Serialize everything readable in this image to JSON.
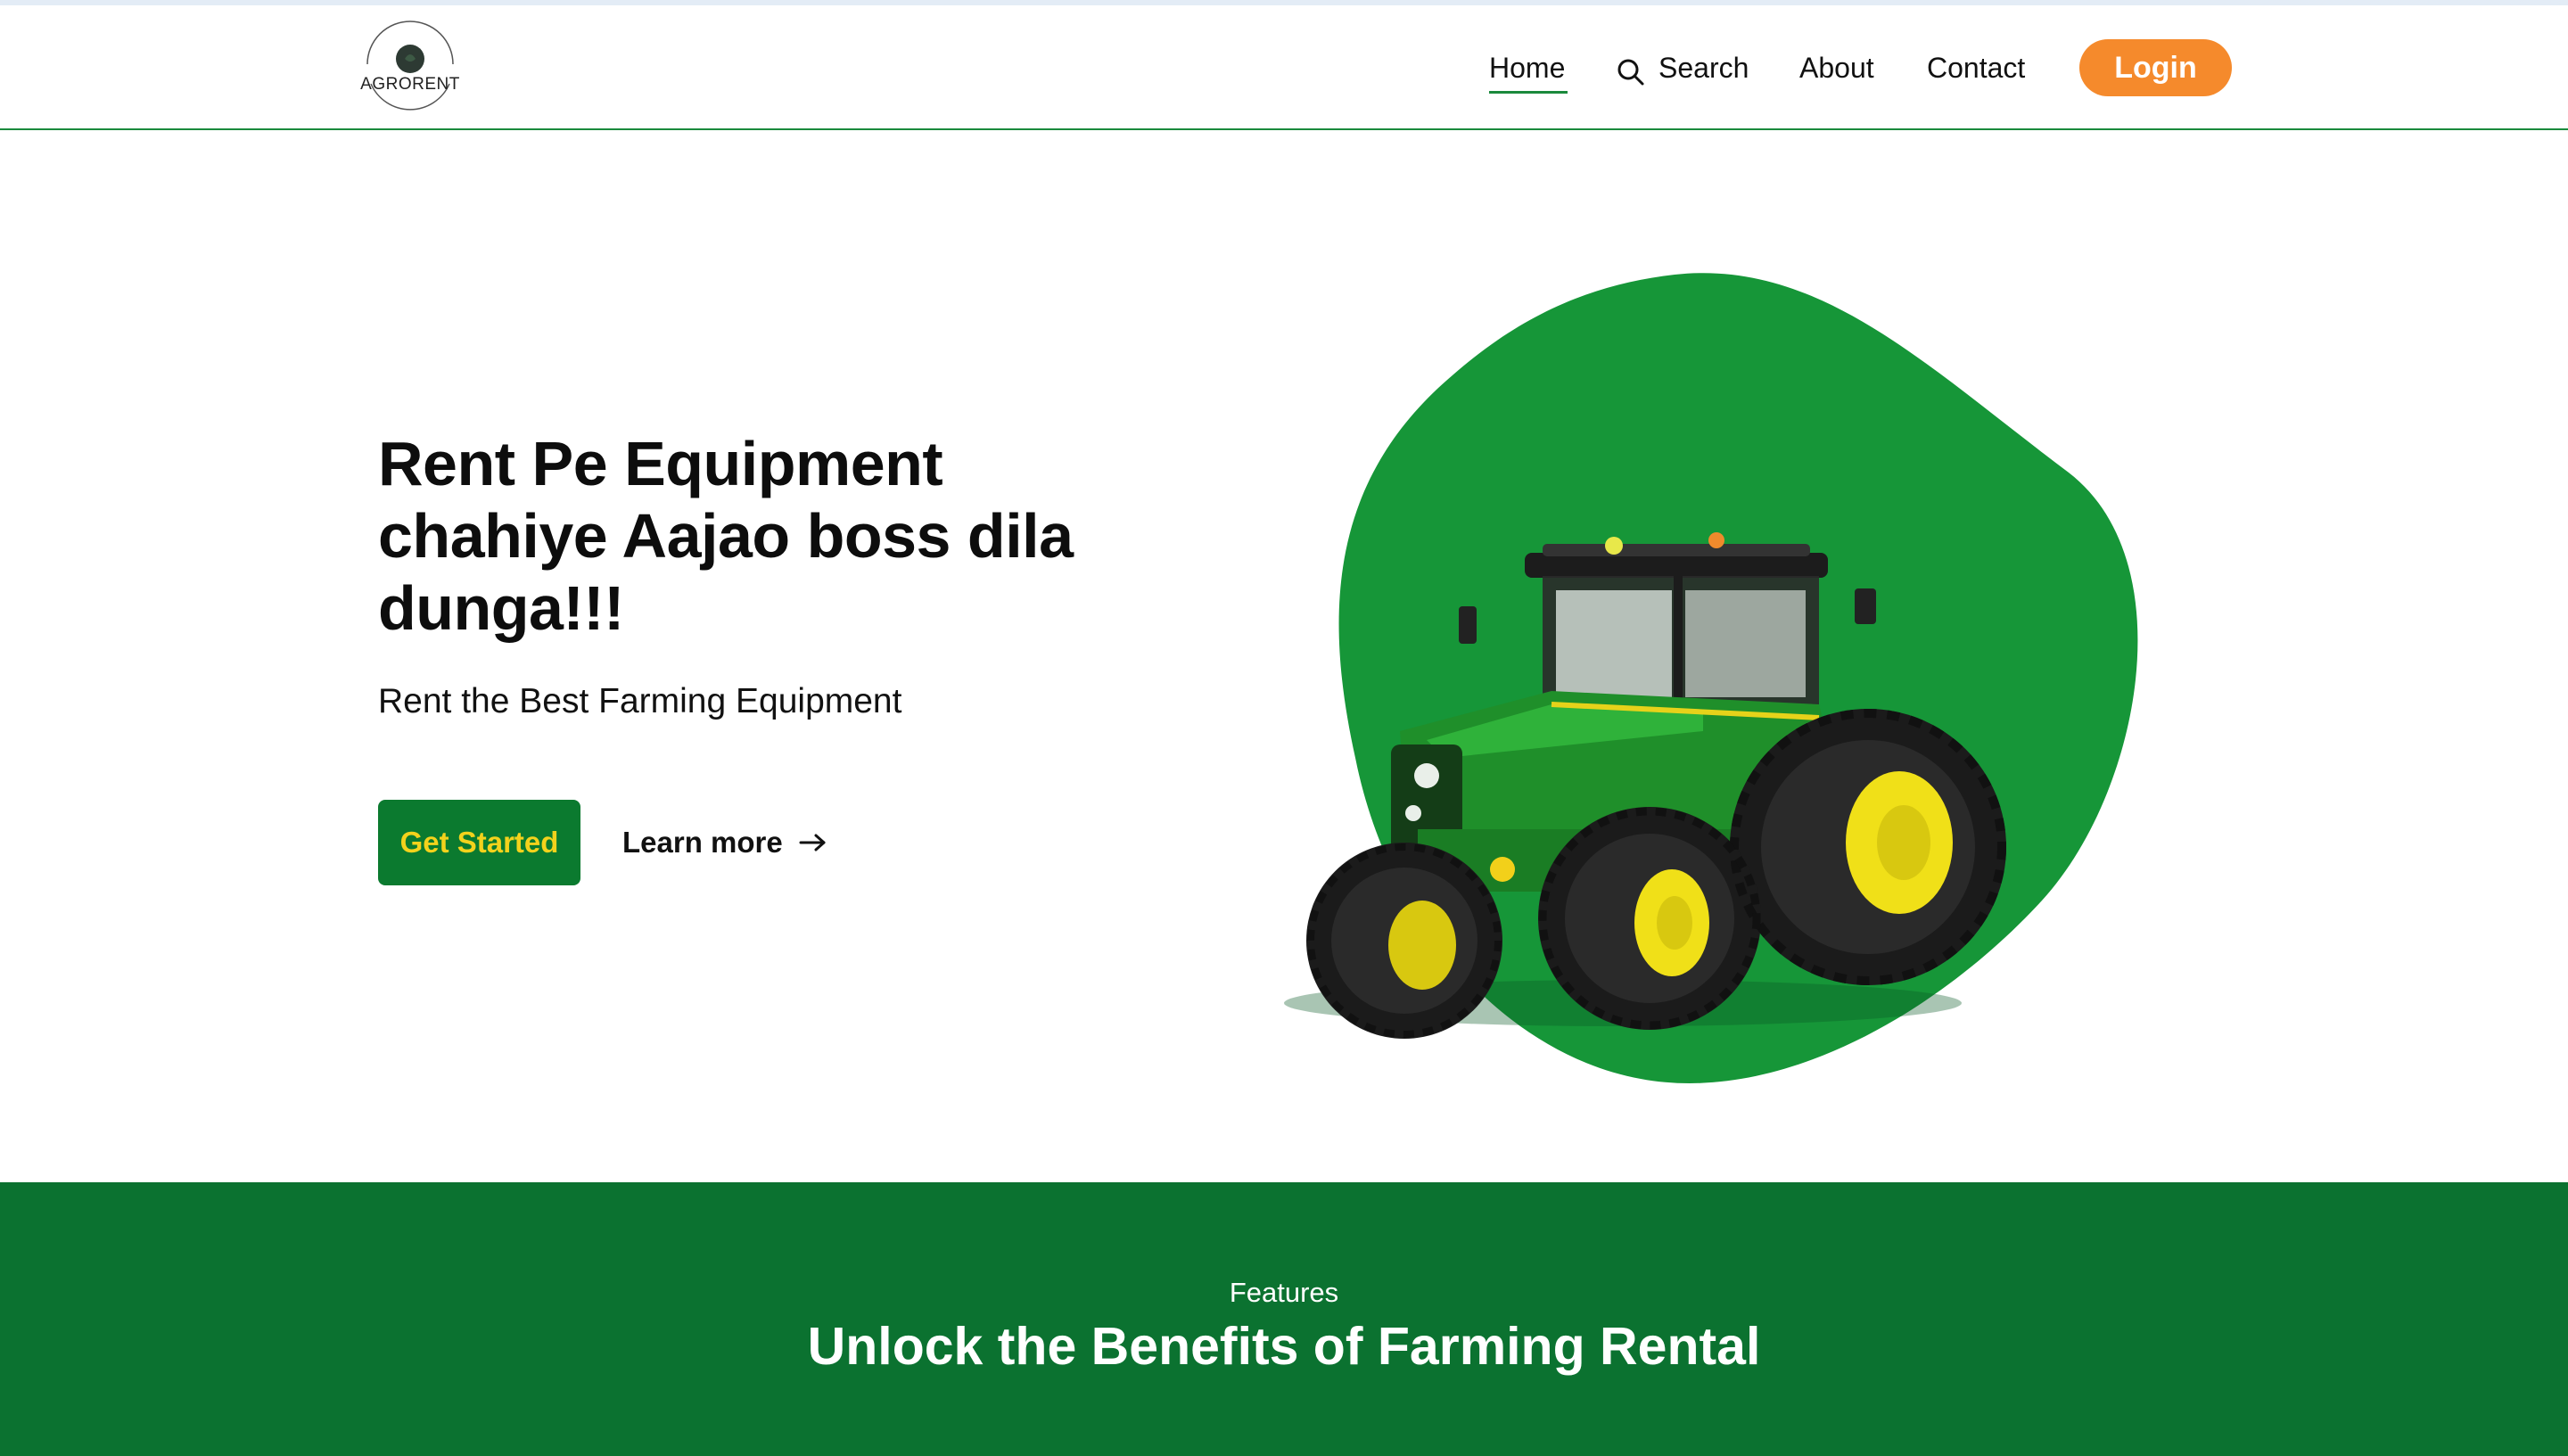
{
  "brand": {
    "name": "AGRORENT"
  },
  "nav": {
    "home": "Home",
    "search": "Search",
    "about": "About",
    "contact": "Contact",
    "login": "Login"
  },
  "hero": {
    "title": "Rent Pe Equipment chahiye Aajao boss dila dunga!!!",
    "subtitle": "Rent the Best Farming Equipment",
    "cta_primary": "Get Started",
    "cta_secondary": "Learn more",
    "image": "green-tractor-illustration"
  },
  "features": {
    "label": "Features",
    "title": "Unlock the Benefits of Farming Rental"
  },
  "colors": {
    "brand_green": "#0b7a2f",
    "blob_green": "#169638",
    "login_orange": "#f58a2c",
    "cta_text_yellow": "#f3d21c",
    "features_bg": "#0b7230"
  },
  "icons": [
    "search-icon",
    "arrow-right-icon",
    "logo-icon"
  ]
}
